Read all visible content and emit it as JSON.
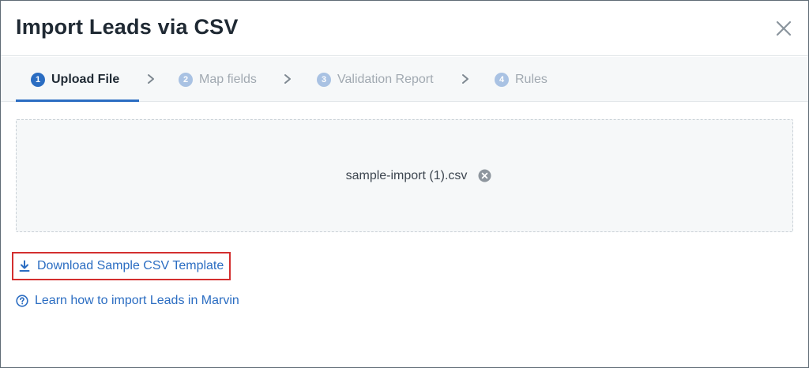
{
  "dialog": {
    "title": "Import Leads via CSV"
  },
  "steps": [
    {
      "number": "1",
      "label": "Upload File",
      "state": "active"
    },
    {
      "number": "2",
      "label": "Map fields",
      "state": "inactive"
    },
    {
      "number": "3",
      "label": "Validation Report",
      "state": "inactive"
    },
    {
      "number": "4",
      "label": "Rules",
      "state": "inactive"
    }
  ],
  "upload": {
    "file_name": "sample-import (1).csv"
  },
  "links": {
    "download_template": "Download Sample CSV Template",
    "learn_import": "Learn how to import Leads in Marvin"
  },
  "colors": {
    "accent": "#2b6dc2",
    "inactive_step": "#a9c2e3",
    "highlight_box": "#d32f2f"
  },
  "icons": {
    "close": "close-icon",
    "chevron": "chevron-right-icon",
    "remove_file": "remove-circle-icon",
    "download": "download-icon",
    "help": "help-circle-icon"
  }
}
